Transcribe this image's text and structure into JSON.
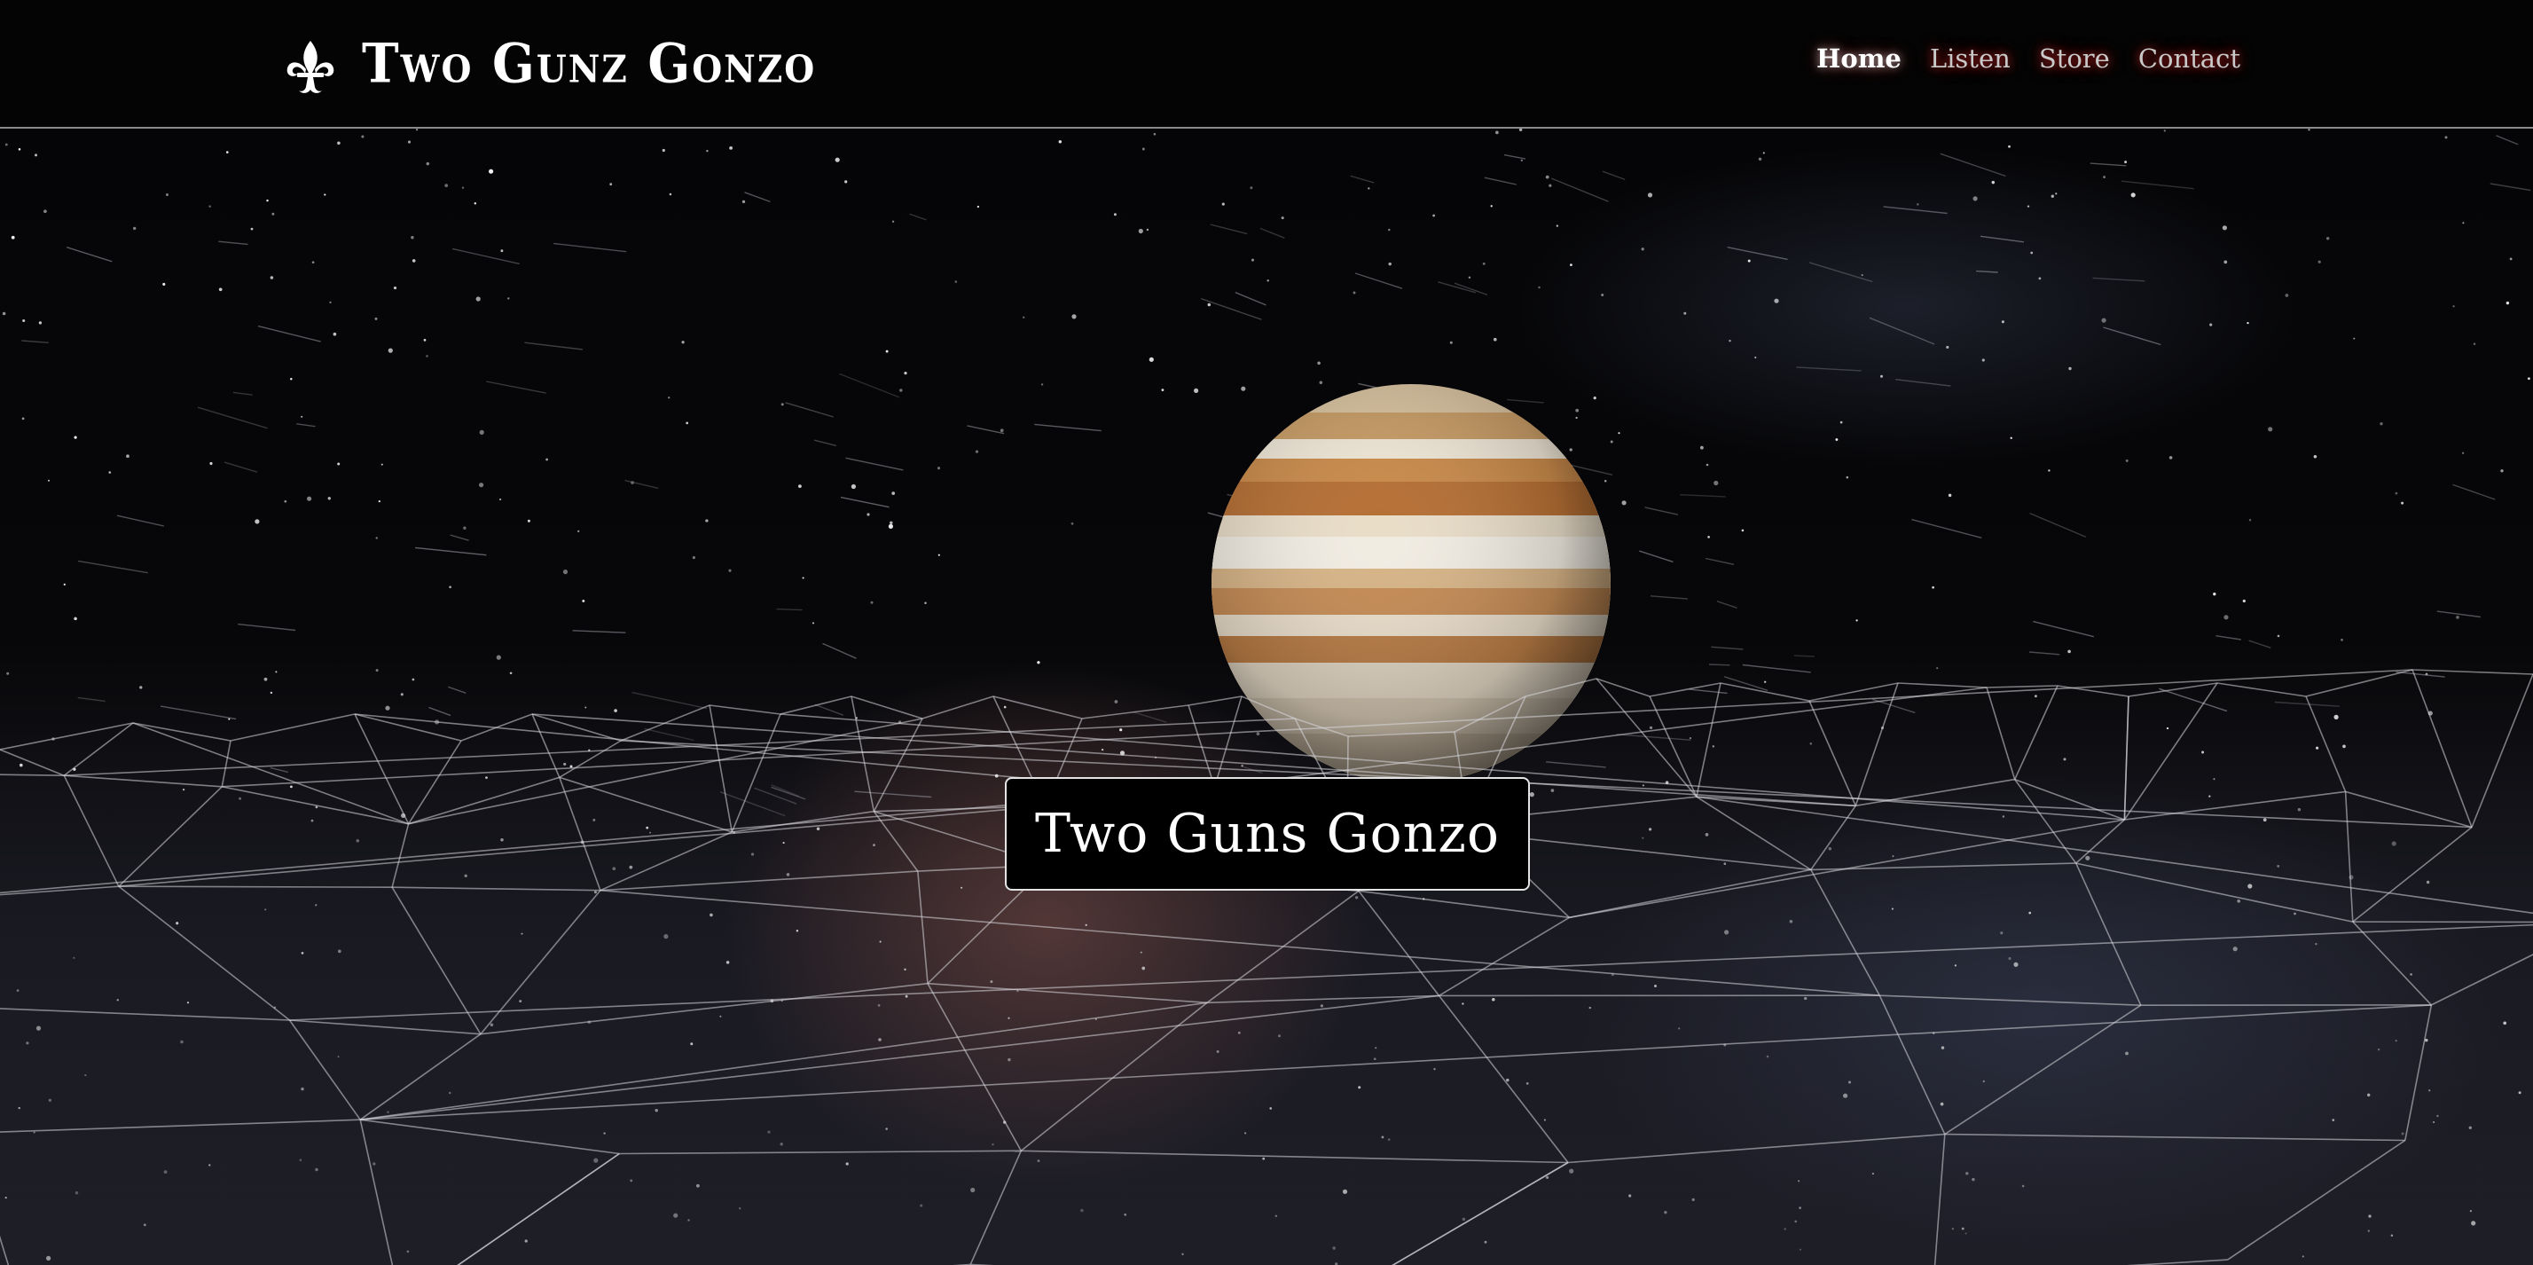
{
  "header": {
    "logo_icon": "fleur-de-lis-icon",
    "brand": "Two Gunz Gonzo",
    "nav": [
      {
        "label": "Home",
        "active": true
      },
      {
        "label": "Listen",
        "active": false
      },
      {
        "label": "Store",
        "active": false
      },
      {
        "label": "Contact",
        "active": false
      }
    ]
  },
  "hero": {
    "background": "starfield with wireframe mountains and a rising gas-giant planet",
    "title": "Two Guns Gonzo"
  },
  "colors": {
    "header_bg": "#040404",
    "nav_glow": "#b02020",
    "text": "#ffffff",
    "title_box_bg": "#000000"
  }
}
